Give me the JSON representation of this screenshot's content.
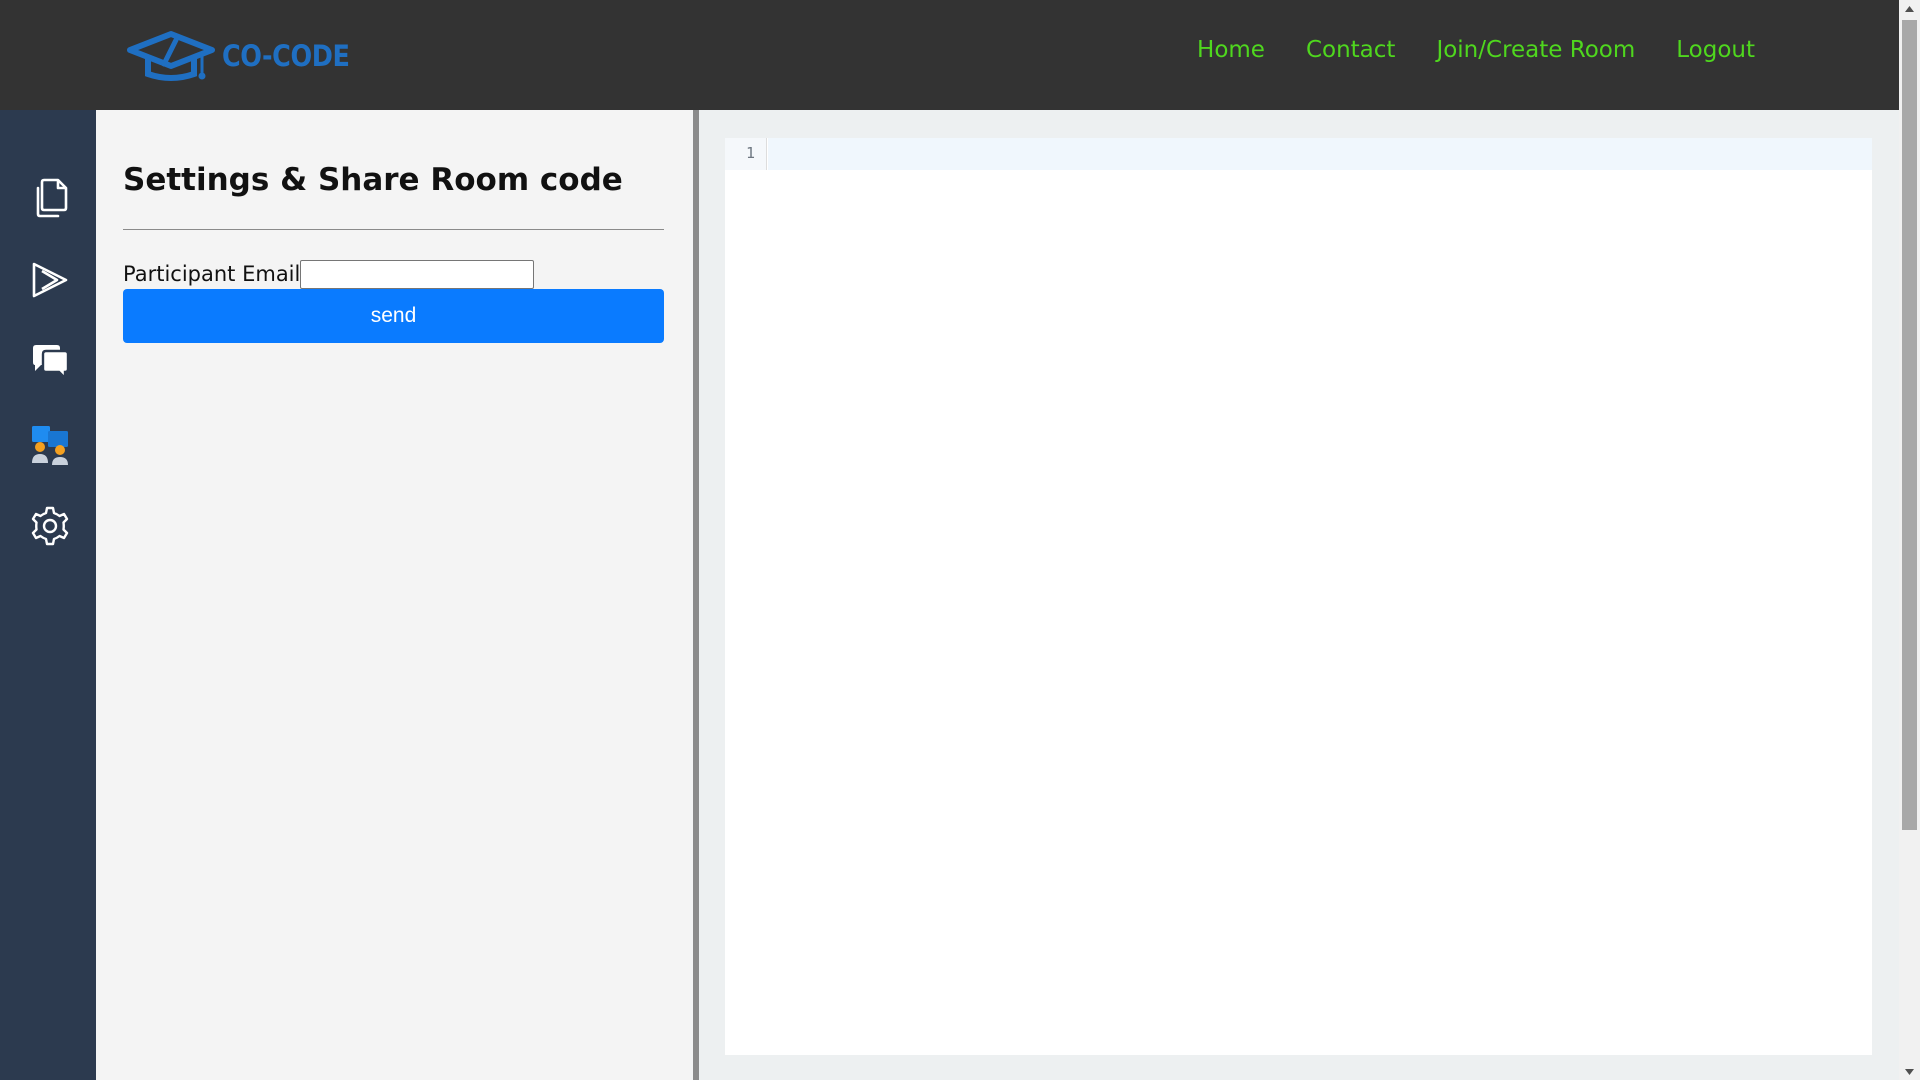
{
  "app": {
    "brand_name": "CO-CODE",
    "logo_icon": "graduation-cap-code-icon",
    "brand_color": "#1f6fc2"
  },
  "nav": {
    "links": [
      {
        "label": "Home"
      },
      {
        "label": "Contact"
      },
      {
        "label": "Join/Create Room"
      },
      {
        "label": "Logout"
      }
    ],
    "link_color": "#4fd71e",
    "background": "#333333"
  },
  "sidebar": {
    "items": [
      {
        "icon": "files-icon"
      },
      {
        "icon": "run-icon"
      },
      {
        "icon": "chat-icon"
      },
      {
        "icon": "participants-icon"
      },
      {
        "icon": "settings-icon"
      }
    ],
    "background": "#2c3a4f"
  },
  "settings_panel": {
    "title": "Settings & Share Room code",
    "email_label": "Participant Email",
    "email_value": "",
    "send_label": "send",
    "send_color": "#0a7bff"
  },
  "editor": {
    "line_numbers": [
      "1"
    ],
    "content": ""
  }
}
